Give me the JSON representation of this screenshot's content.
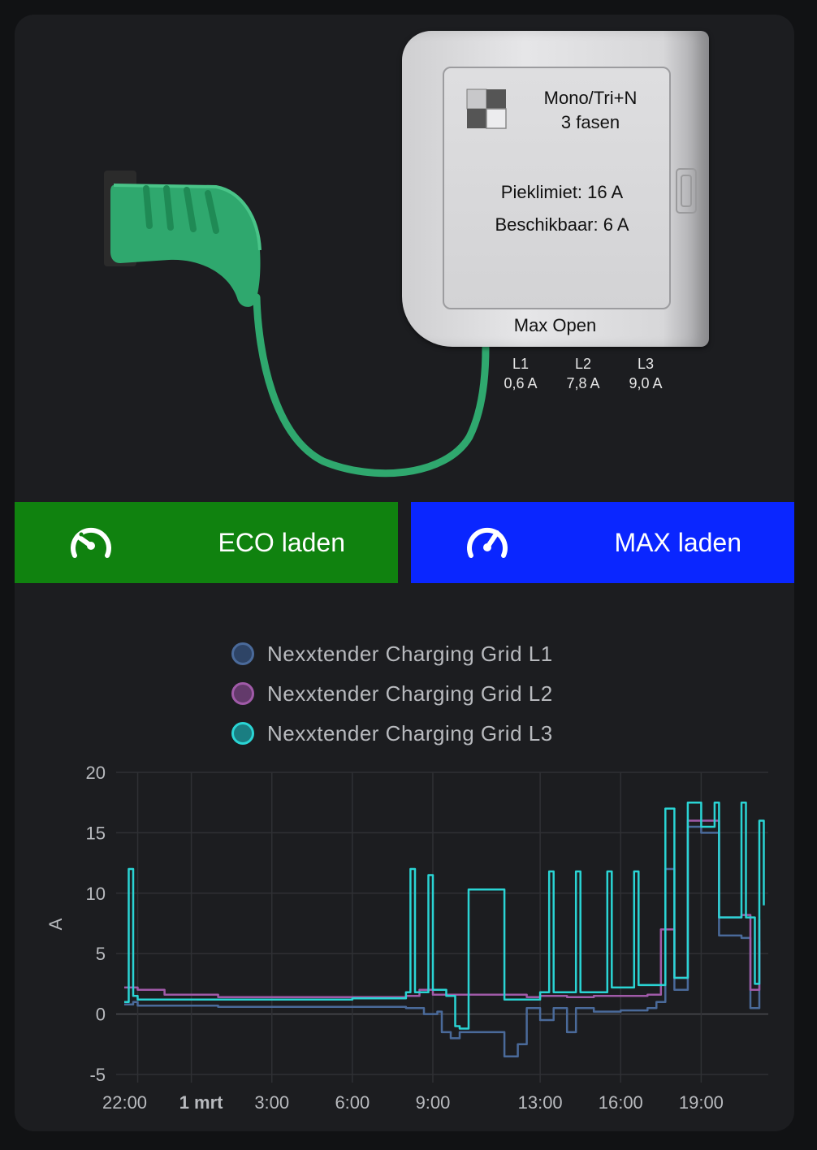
{
  "charger": {
    "phase_type_line1": "Mono/Tri+N",
    "phase_type_line2": "3 fasen",
    "peak_limit": "Pieklimiet: 16 A",
    "available": "Beschikbaar: 6 A",
    "name": "Max Open",
    "phases": [
      {
        "label": "L1",
        "value": "0,6 A"
      },
      {
        "label": "L2",
        "value": "7,8 A"
      },
      {
        "label": "L3",
        "value": "9,0 A"
      }
    ],
    "icons": [
      "ev-plug-icon",
      "charger-logo-icon"
    ]
  },
  "buttons": {
    "eco_label": "ECO laden",
    "eco_icon": "speedometer-slow-icon",
    "max_label": "MAX laden",
    "max_icon": "speedometer-fast-icon"
  },
  "colors": {
    "eco": "#10820f",
    "max": "#0a26ff",
    "cable": "#2fa86e",
    "l1": "#4a6a9a",
    "l2": "#a05aa8",
    "l3": "#2ad4d4"
  },
  "chart_data": {
    "type": "line",
    "ylabel": "A",
    "ylim": [
      -5,
      20
    ],
    "yticks": [
      20,
      15,
      10,
      5,
      0,
      -5
    ],
    "xtick_labels": [
      "22:00",
      "1 mrt",
      "3:00",
      "6:00",
      "9:00",
      "13:00",
      "16:00",
      "19:00"
    ],
    "grid": true,
    "legend_placement": "top-center",
    "series": [
      {
        "name": "Nexxtender Charging Grid L1",
        "color": "#4a6a9a",
        "points": [
          [
            "21:30",
            0.8
          ],
          [
            "21:50",
            1.0
          ],
          [
            "22:00",
            0.7
          ],
          [
            "23:00",
            0.7
          ],
          [
            "1:00",
            0.6
          ],
          [
            "3:00",
            0.6
          ],
          [
            "5:00",
            0.6
          ],
          [
            "6:00",
            0.6
          ],
          [
            "7:00",
            0.6
          ],
          [
            "8:00",
            0.5
          ],
          [
            "8:20",
            0.5
          ],
          [
            "8:40",
            0.0
          ],
          [
            "9:10",
            0.2
          ],
          [
            "9:20",
            -1.5
          ],
          [
            "9:40",
            -2.0
          ],
          [
            "10:00",
            -1.5
          ],
          [
            "11:00",
            -1.5
          ],
          [
            "11:30",
            -1.5
          ],
          [
            "11:40",
            -3.5
          ],
          [
            "12:10",
            -2.5
          ],
          [
            "12:30",
            0.5
          ],
          [
            "13:00",
            -0.5
          ],
          [
            "13:30",
            0.5
          ],
          [
            "14:00",
            -1.5
          ],
          [
            "14:20",
            0.5
          ],
          [
            "15:00",
            0.2
          ],
          [
            "16:00",
            0.3
          ],
          [
            "17:00",
            0.5
          ],
          [
            "17:20",
            1.0
          ],
          [
            "17:40",
            12.0
          ],
          [
            "18:00",
            2.0
          ],
          [
            "18:30",
            15.5
          ],
          [
            "19:00",
            15.0
          ],
          [
            "19:40",
            6.5
          ],
          [
            "20:30",
            6.3
          ],
          [
            "20:50",
            0.5
          ],
          [
            "21:10",
            6.0
          ]
        ]
      },
      {
        "name": "Nexxtender Charging Grid L2",
        "color": "#a05aa8",
        "points": [
          [
            "21:30",
            2.2
          ],
          [
            "22:00",
            2.0
          ],
          [
            "23:00",
            1.6
          ],
          [
            "1:00",
            1.4
          ],
          [
            "3:00",
            1.4
          ],
          [
            "5:00",
            1.4
          ],
          [
            "6:00",
            1.4
          ],
          [
            "7:00",
            1.4
          ],
          [
            "8:00",
            1.5
          ],
          [
            "8:30",
            2.0
          ],
          [
            "9:00",
            1.6
          ],
          [
            "10:00",
            1.6
          ],
          [
            "11:00",
            1.6
          ],
          [
            "12:00",
            1.6
          ],
          [
            "12:30",
            1.4
          ],
          [
            "13:00",
            1.5
          ],
          [
            "14:00",
            1.4
          ],
          [
            "15:00",
            1.5
          ],
          [
            "16:00",
            1.5
          ],
          [
            "17:00",
            1.6
          ],
          [
            "17:30",
            7.0
          ],
          [
            "18:00",
            3.0
          ],
          [
            "18:30",
            16.0
          ],
          [
            "19:00",
            16.0
          ],
          [
            "19:40",
            8.0
          ],
          [
            "20:30",
            8.2
          ],
          [
            "20:50",
            2.0
          ],
          [
            "21:10",
            7.8
          ]
        ]
      },
      {
        "name": "Nexxtender Charging Grid L3",
        "color": "#2ad4d4",
        "points": [
          [
            "21:30",
            1.0
          ],
          [
            "21:40",
            12.0
          ],
          [
            "21:50",
            1.5
          ],
          [
            "22:00",
            1.2
          ],
          [
            "23:00",
            1.2
          ],
          [
            "1:00",
            1.2
          ],
          [
            "3:00",
            1.2
          ],
          [
            "5:00",
            1.2
          ],
          [
            "6:00",
            1.3
          ],
          [
            "7:00",
            1.3
          ],
          [
            "8:00",
            1.8
          ],
          [
            "8:10",
            12.0
          ],
          [
            "8:20",
            1.8
          ],
          [
            "8:50",
            11.5
          ],
          [
            "9:00",
            2.0
          ],
          [
            "9:30",
            1.5
          ],
          [
            "9:50",
            -1.0
          ],
          [
            "10:00",
            -1.2
          ],
          [
            "10:20",
            10.3
          ],
          [
            "11:30",
            10.3
          ],
          [
            "11:40",
            1.2
          ],
          [
            "12:00",
            1.2
          ],
          [
            "13:00",
            1.8
          ],
          [
            "13:20",
            11.8
          ],
          [
            "13:30",
            1.8
          ],
          [
            "14:20",
            11.8
          ],
          [
            "14:30",
            1.8
          ],
          [
            "15:30",
            11.8
          ],
          [
            "15:40",
            2.2
          ],
          [
            "16:30",
            11.8
          ],
          [
            "16:40",
            2.4
          ],
          [
            "17:20",
            2.4
          ],
          [
            "17:40",
            17.0
          ],
          [
            "18:00",
            3.0
          ],
          [
            "18:30",
            17.5
          ],
          [
            "19:00",
            15.5
          ],
          [
            "19:30",
            17.5
          ],
          [
            "19:40",
            8.0
          ],
          [
            "20:30",
            17.5
          ],
          [
            "20:40",
            8.0
          ],
          [
            "21:00",
            2.5
          ],
          [
            "21:10",
            16.0
          ],
          [
            "21:20",
            9.0
          ]
        ]
      }
    ]
  }
}
